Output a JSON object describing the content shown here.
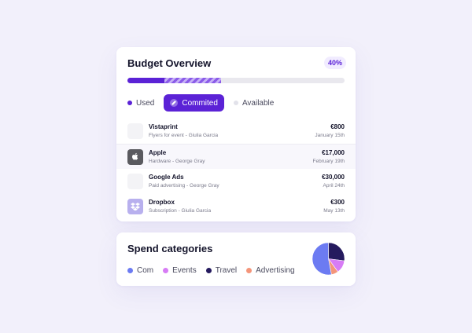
{
  "budget": {
    "title": "Budget Overview",
    "percent": "40%",
    "used_fraction": 0.17,
    "committed_fraction": 0.26,
    "legend": [
      {
        "label": "Used",
        "color": "#5b22d6"
      },
      {
        "label": "Commited",
        "color": "#5b22d6"
      },
      {
        "label": "Available",
        "color": "#e2e2ea"
      }
    ],
    "rows": [
      {
        "name": "Vistaprint",
        "sub": "Flyers for event - Giulia Garcia",
        "amount": "€800",
        "date": "January 15th",
        "logo": "vistaprint-logo",
        "logo_color": "#f3f3f6"
      },
      {
        "name": "Apple",
        "sub": "Hardware - George Gray",
        "amount": "€17,000",
        "date": "February 19th",
        "logo": "apple-logo",
        "logo_color": "#5a5a5f"
      },
      {
        "name": "Google Ads",
        "sub": "Paid advertising - George Gray",
        "amount": "€30,000",
        "date": "April 24th",
        "logo": "google-ads-logo",
        "logo_color": "#f3f3f6"
      },
      {
        "name": "Dropbox",
        "sub": "Subscription - Giulia Garcia",
        "amount": "€300",
        "date": "May 13th",
        "logo": "dropbox-logo",
        "logo_color": "#b8b0ee"
      }
    ]
  },
  "spend": {
    "title": "Spend categories",
    "legend": [
      {
        "label": "Com",
        "color": "#6c7bf2"
      },
      {
        "label": "Events",
        "color": "#d77cf5"
      },
      {
        "label": "Travel",
        "color": "#251a5e"
      },
      {
        "label": "Advertising",
        "color": "#f4957a"
      }
    ],
    "pie": [
      {
        "category": "Travel",
        "fraction": 0.27,
        "color": "#251a5e"
      },
      {
        "category": "Events",
        "fraction": 0.13,
        "color": "#d77cf5"
      },
      {
        "category": "Advertising",
        "fraction": 0.07,
        "color": "#f4957a"
      },
      {
        "category": "Com",
        "fraction": 0.53,
        "color": "#6c7bf2"
      }
    ]
  }
}
